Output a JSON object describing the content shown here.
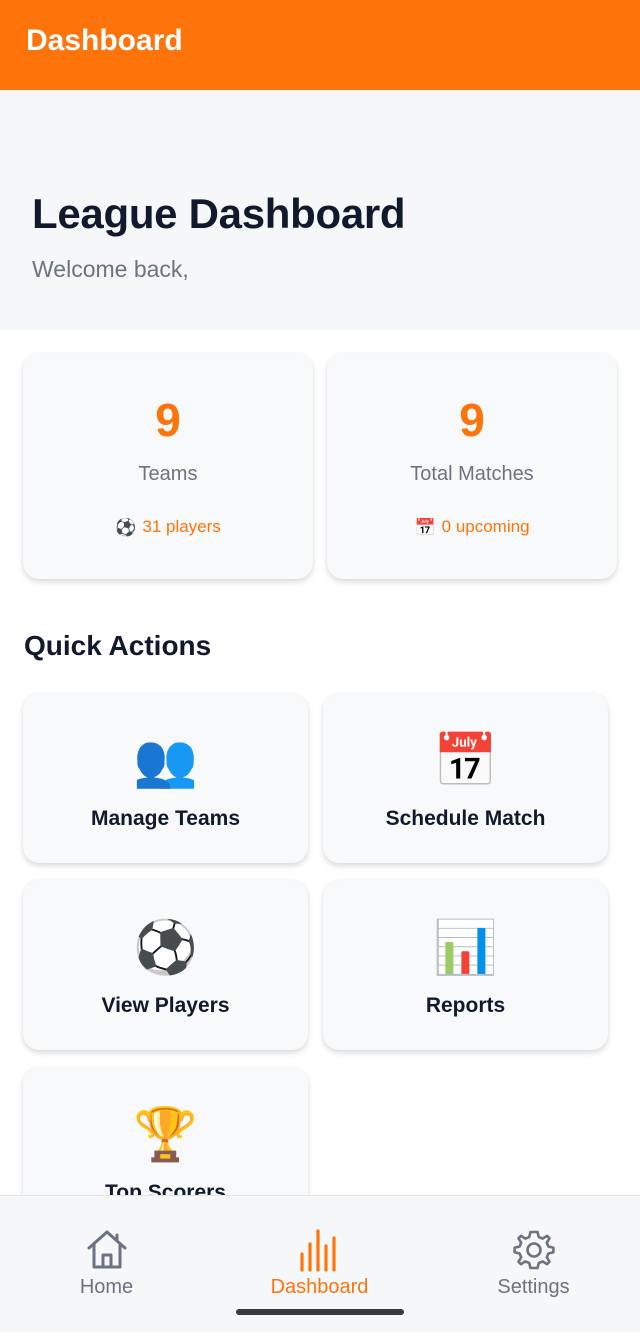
{
  "appbar": {
    "title": "Dashboard"
  },
  "hero": {
    "title": "League Dashboard",
    "subtitle": "Welcome back,"
  },
  "stats": [
    {
      "value": "9",
      "label": "Teams",
      "sub_icon": "soccer-ball-icon",
      "sub_glyph": "⚽",
      "sub_text": "31 players"
    },
    {
      "value": "9",
      "label": "Total Matches",
      "sub_icon": "calendar-icon",
      "sub_glyph": "📅",
      "sub_text": "0 upcoming"
    }
  ],
  "quick_actions": {
    "title": "Quick Actions",
    "items": [
      {
        "label": "Manage Teams",
        "icon": "people-icon",
        "glyph": "👥"
      },
      {
        "label": "Schedule Match",
        "icon": "calendar-icon",
        "glyph": "📅"
      },
      {
        "label": "View Players",
        "icon": "soccer-ball-icon",
        "glyph": "⚽"
      },
      {
        "label": "Reports",
        "icon": "bar-chart-icon",
        "glyph": "📊"
      },
      {
        "label": "Top Scorers",
        "icon": "trophy-icon",
        "glyph": "🏆"
      }
    ]
  },
  "bottom_nav": {
    "items": [
      {
        "label": "Home",
        "icon": "home-icon",
        "active": false
      },
      {
        "label": "Dashboard",
        "icon": "bar-chart-icon",
        "active": true
      },
      {
        "label": "Settings",
        "icon": "gear-icon",
        "active": false
      }
    ]
  },
  "colors": {
    "accent": "#ff740a",
    "text_dark": "#111a2c",
    "text_muted": "#6b7280",
    "card_bg": "#f8f9fa"
  }
}
